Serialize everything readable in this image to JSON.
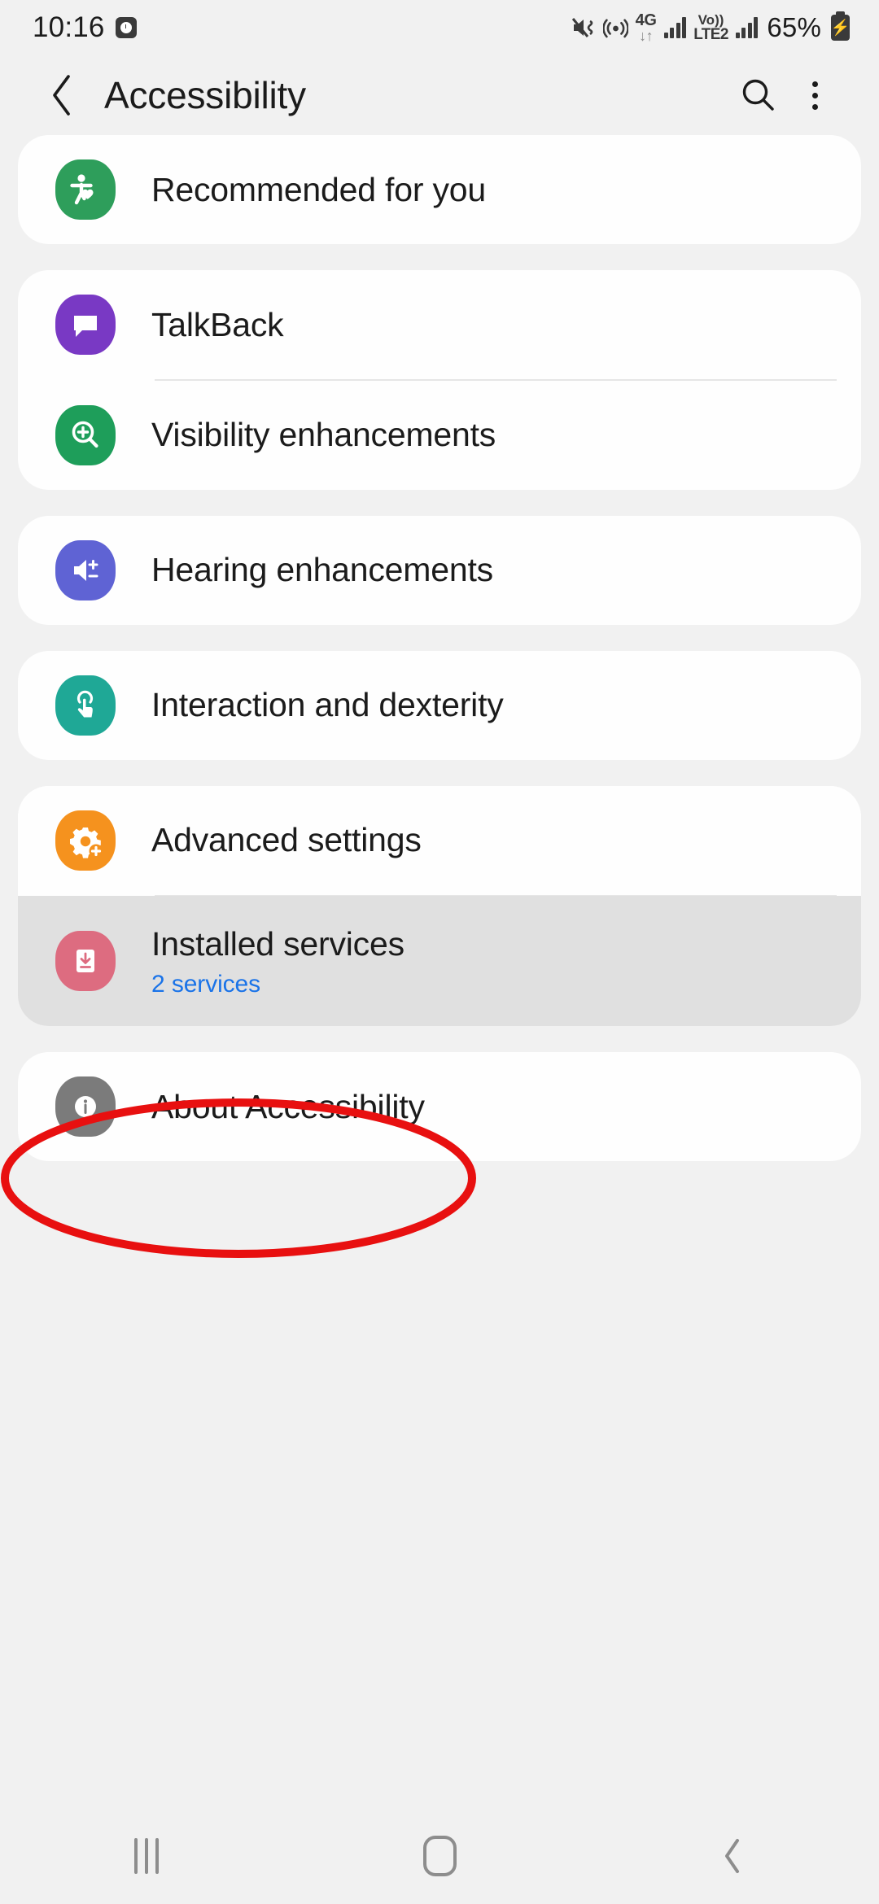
{
  "status_bar": {
    "time": "10:16",
    "alarm_icon": "alarm-clock-icon",
    "mute_icon": "sound-off-vibrate-icon",
    "hotspot_icon": "mobile-hotspot-icon",
    "network_type_top": "4G",
    "network_type_bottom": "↓↑",
    "volte_top": "Vo))",
    "volte_bottom": "LTE2",
    "battery_percent": "65%",
    "battery_icon": "battery-charging-icon"
  },
  "header": {
    "back_icon": "back-chevron-icon",
    "title": "Accessibility",
    "search_icon": "search-icon",
    "more_icon": "more-options-icon"
  },
  "groups": [
    {
      "highlighted": false,
      "items": [
        {
          "title": "Recommended for you",
          "subtitle": "",
          "icon": "accessibility-person-heart-icon",
          "icon_color": "#2e9e5b"
        }
      ]
    },
    {
      "highlighted": false,
      "items": [
        {
          "title": "TalkBack",
          "subtitle": "",
          "icon": "speech-bubble-icon",
          "icon_color": "#7939c4"
        },
        {
          "title": "Visibility enhancements",
          "subtitle": "",
          "icon": "magnifier-plus-icon",
          "icon_color": "#1e9e5a"
        }
      ]
    },
    {
      "highlighted": false,
      "items": [
        {
          "title": "Hearing enhancements",
          "subtitle": "",
          "icon": "speaker-plus-minus-icon",
          "icon_color": "#5f63d4"
        }
      ]
    },
    {
      "highlighted": false,
      "items": [
        {
          "title": "Interaction and dexterity",
          "subtitle": "",
          "icon": "touch-hand-icon",
          "icon_color": "#1fa896"
        }
      ]
    },
    {
      "highlighted": true,
      "items": [
        {
          "title": "Advanced settings",
          "subtitle": "",
          "icon": "gear-plus-icon",
          "icon_color": "#f5921e"
        },
        {
          "title": "Installed services",
          "subtitle": "2 services",
          "icon": "download-service-icon",
          "icon_color": "#dd6c80"
        }
      ]
    },
    {
      "highlighted": false,
      "items": [
        {
          "title": "About Accessibility",
          "subtitle": "",
          "icon": "info-circle-icon",
          "icon_color": "#7b7b7b"
        }
      ]
    }
  ],
  "annotation": {
    "shape": "red-ellipse-highlight",
    "target": "Installed services",
    "color": "#e81010"
  },
  "nav_bar": {
    "recents_icon": "recents-icon",
    "home_icon": "home-icon",
    "back_icon": "back-icon"
  },
  "colors": {
    "background": "#f1f1f1",
    "card": "#fefefe",
    "pressed_card": "#e0e0e0",
    "title_text": "#1b1b1b",
    "link_text": "#1a73e8",
    "annotation": "#e81010"
  }
}
